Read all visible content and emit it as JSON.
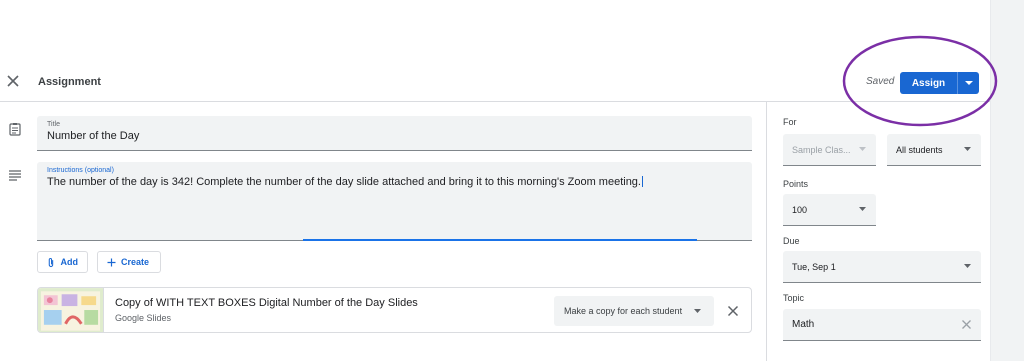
{
  "header": {
    "title": "Assignment",
    "saved": "Saved",
    "assign_label": "Assign"
  },
  "form": {
    "title_label": "Title",
    "title_value": "Number of the Day",
    "instructions_label": "Instructions (optional)",
    "instructions_value": "The number of the day is 342! Complete the number of the day slide attached and bring it to this morning's Zoom meeting."
  },
  "actions": {
    "add_label": "Add",
    "create_label": "Create"
  },
  "attachment": {
    "title": "Copy of WITH TEXT BOXES Digital Number of the Day Slides",
    "subtitle": "Google Slides",
    "sharing": "Make a copy for each student"
  },
  "panel": {
    "for_label": "For",
    "class_value": "Sample Clas...",
    "students_value": "All students",
    "points_label": "Points",
    "points_value": "100",
    "due_label": "Due",
    "due_value": "Tue, Sep 1",
    "topic_label": "Topic",
    "topic_value": "Math"
  },
  "colors": {
    "accent": "#1967d2",
    "annotation": "#7b2fa6"
  }
}
